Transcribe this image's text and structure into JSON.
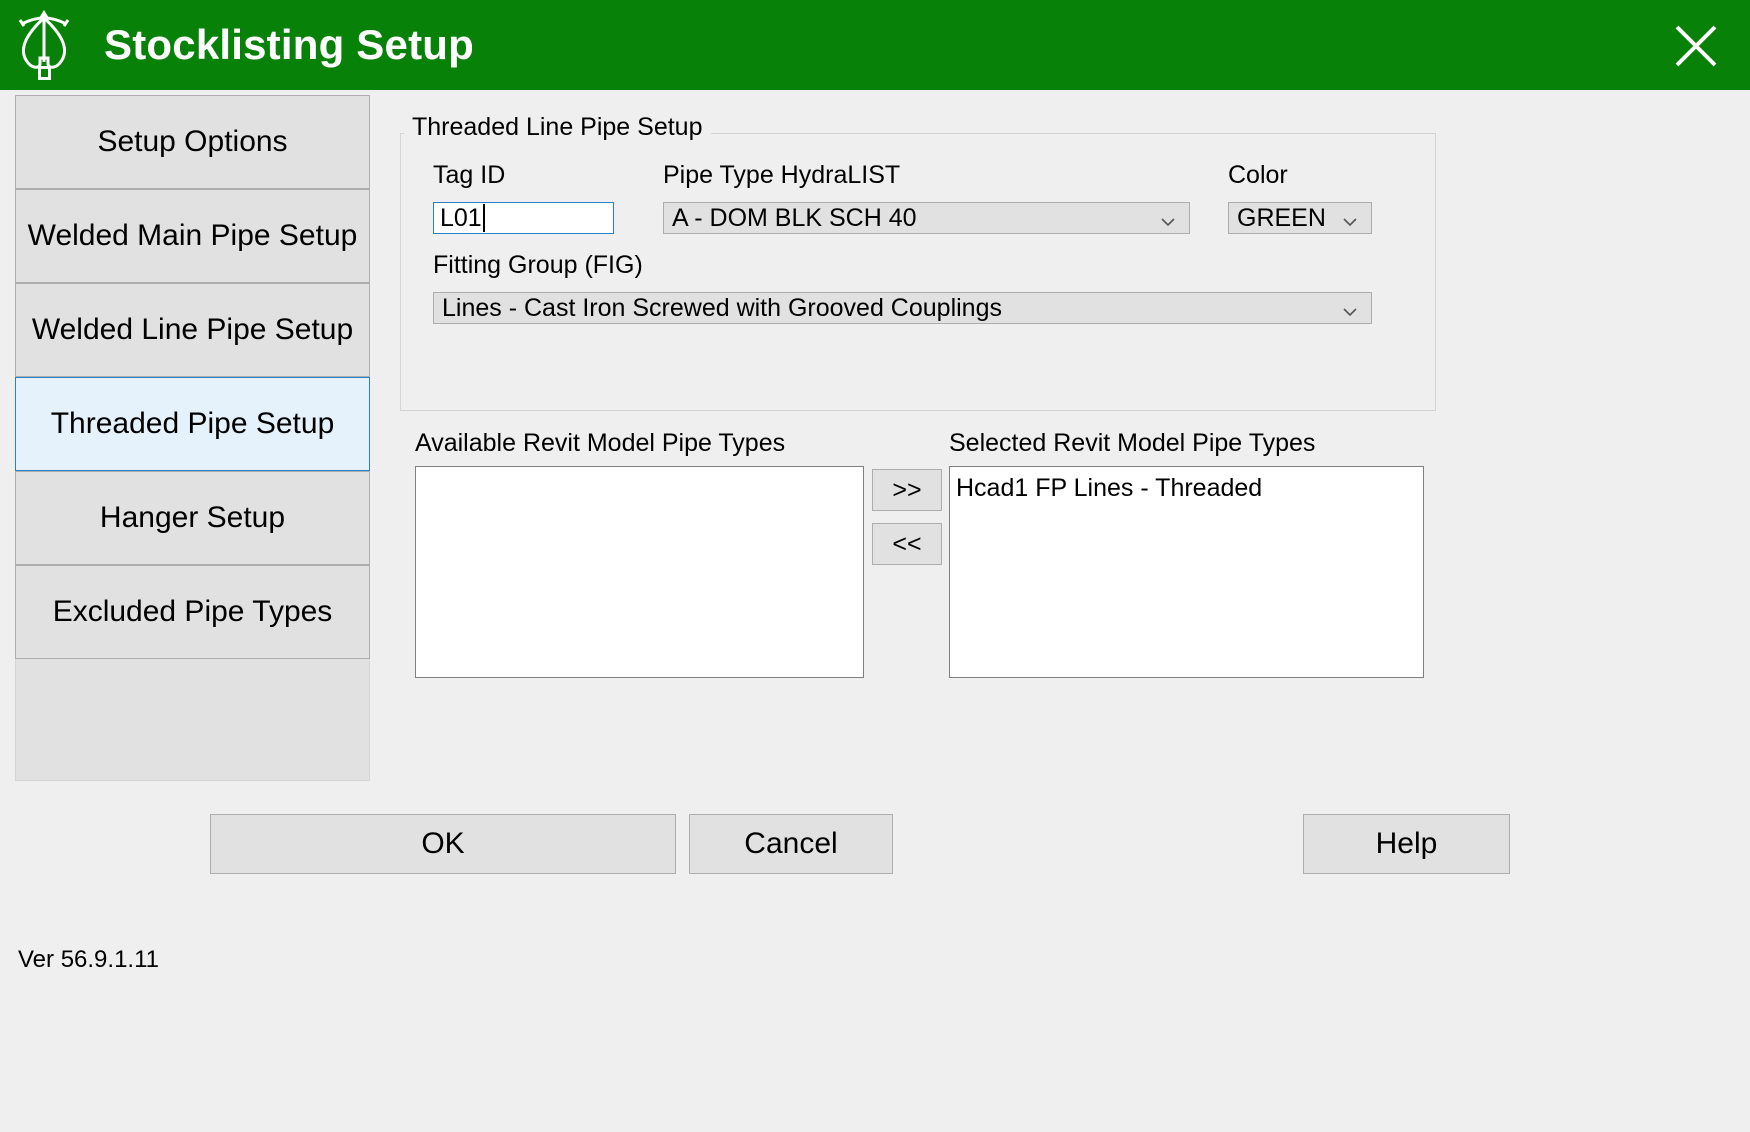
{
  "window": {
    "title": "Stocklisting Setup",
    "icon": "sprinkler-logo-icon",
    "close_label": "×",
    "titlebar_color": "#088108"
  },
  "sidebar": {
    "items": [
      {
        "label": "Setup Options",
        "selected": false
      },
      {
        "label": "Welded Main Pipe Setup",
        "selected": false
      },
      {
        "label": "Welded Line Pipe Setup",
        "selected": false
      },
      {
        "label": "Threaded Pipe Setup",
        "selected": true
      },
      {
        "label": "Hanger Setup",
        "selected": false
      },
      {
        "label": "Excluded Pipe Types",
        "selected": false
      }
    ]
  },
  "group": {
    "title": "Threaded Line Pipe Setup",
    "tag_id": {
      "label": "Tag ID",
      "value": "L01"
    },
    "pipe_type": {
      "label": "Pipe Type HydraLIST",
      "value": "A - DOM BLK SCH 40"
    },
    "color": {
      "label": "Color",
      "value": "GREEN"
    },
    "fitting_group": {
      "label": "Fitting Group (FIG)",
      "value": "Lines - Cast Iron Screwed with Grooved Couplings"
    }
  },
  "transfer": {
    "available_label": "Available Revit Model Pipe Types",
    "selected_label": "Selected Revit Model Pipe Types",
    "add_label": ">>",
    "remove_label": "<<",
    "available_items": [],
    "selected_items": [
      "Hcad1 FP Lines - Threaded"
    ]
  },
  "footer": {
    "version": "Ver 56.9.1.11",
    "ok_label": "OK",
    "cancel_label": "Cancel",
    "help_label": "Help"
  }
}
